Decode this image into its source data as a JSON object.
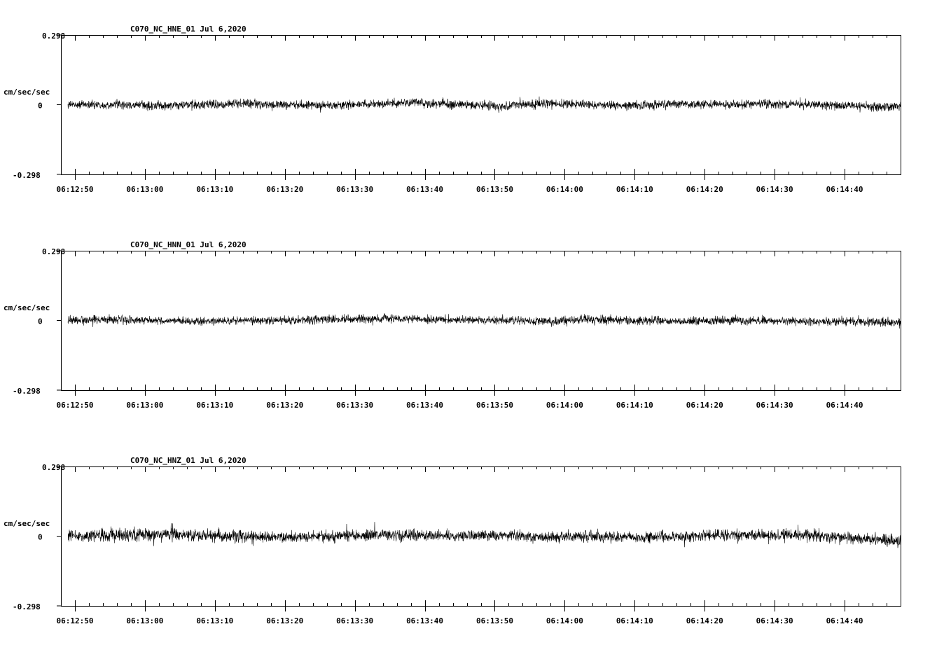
{
  "chart_data": [
    {
      "type": "line",
      "title": "C070_NC_HNE_01   Jul 6,2020",
      "ylabel": "cm/sec/sec",
      "ylim": [
        -0.298,
        0.298
      ],
      "yticks": [
        "0.298",
        "0",
        "-0.298"
      ],
      "xlim": [
        "06:12:48",
        "06:14:48"
      ],
      "xticks": [
        "06:12:50",
        "06:13:00",
        "06:13:10",
        "06:13:20",
        "06:13:30",
        "06:13:40",
        "06:13:50",
        "06:14:00",
        "06:14:10",
        "06:14:20",
        "06:14:30",
        "06:14:40"
      ],
      "series": [
        {
          "x_start": "06:12:49",
          "x_end": "06:14:48",
          "values": [
            0.0,
            0.0,
            -0.005,
            0.0,
            0.005,
            0.0,
            -0.004,
            0.004,
            0.008,
            0.0,
            -0.005,
            0.005,
            0.0,
            -0.004,
            0.003,
            0.0,
            0.005,
            0.0,
            -0.006,
            -0.012
          ],
          "noise_amplitude": [
            0.04,
            0.045,
            0.05,
            0.05,
            0.055,
            0.05,
            0.045,
            0.05,
            0.05,
            0.05,
            0.05,
            0.055,
            0.045,
            0.05,
            0.05,
            0.045,
            0.05,
            0.045,
            0.05,
            0.055
          ]
        }
      ]
    },
    {
      "type": "line",
      "title": "C070_NC_HNN_01   Jul 6,2020",
      "ylabel": "cm/sec/sec",
      "ylim": [
        -0.298,
        0.298
      ],
      "yticks": [
        "0.298",
        "0",
        "-0.298"
      ],
      "xlim": [
        "06:12:48",
        "06:14:48"
      ],
      "xticks": [
        "06:12:50",
        "06:13:00",
        "06:13:10",
        "06:13:20",
        "06:13:30",
        "06:13:40",
        "06:13:50",
        "06:14:00",
        "06:14:10",
        "06:14:20",
        "06:14:30",
        "06:14:40"
      ],
      "series": [
        {
          "x_start": "06:12:49",
          "x_end": "06:14:48",
          "values": [
            0.0,
            0.005,
            0.0,
            -0.004,
            0.0,
            0.0,
            0.005,
            0.008,
            0.005,
            0.003,
            0.0,
            -0.005,
            0.005,
            0.0,
            -0.004,
            0.0,
            0.0,
            -0.005,
            -0.004,
            -0.01
          ],
          "noise_amplitude": [
            0.045,
            0.05,
            0.045,
            0.04,
            0.045,
            0.045,
            0.05,
            0.05,
            0.045,
            0.045,
            0.04,
            0.05,
            0.055,
            0.05,
            0.045,
            0.05,
            0.045,
            0.045,
            0.045,
            0.055
          ]
        }
      ]
    },
    {
      "type": "line",
      "title": "C070_NC_HNZ_01   Jul 6,2020",
      "ylabel": "cm/sec/sec",
      "ylim": [
        -0.298,
        0.298
      ],
      "yticks": [
        "0.298",
        "0",
        "-0.298"
      ],
      "xlim": [
        "06:12:48",
        "06:14:48"
      ],
      "xticks": [
        "06:12:50",
        "06:13:00",
        "06:13:10",
        "06:13:20",
        "06:13:30",
        "06:13:40",
        "06:13:50",
        "06:14:00",
        "06:14:10",
        "06:14:20",
        "06:14:30",
        "06:14:40"
      ],
      "series": [
        {
          "x_start": "06:12:49",
          "x_end": "06:14:48",
          "values": [
            0.0,
            0.005,
            0.005,
            0.003,
            0.0,
            -0.005,
            0.0,
            0.004,
            0.005,
            0.0,
            0.005,
            -0.004,
            0.0,
            -0.005,
            0.0,
            0.005,
            0.005,
            0.005,
            -0.01,
            -0.02
          ],
          "noise_amplitude": [
            0.06,
            0.075,
            0.075,
            0.07,
            0.07,
            0.06,
            0.065,
            0.07,
            0.065,
            0.065,
            0.06,
            0.065,
            0.065,
            0.065,
            0.06,
            0.065,
            0.065,
            0.065,
            0.065,
            0.075
          ]
        }
      ]
    }
  ]
}
